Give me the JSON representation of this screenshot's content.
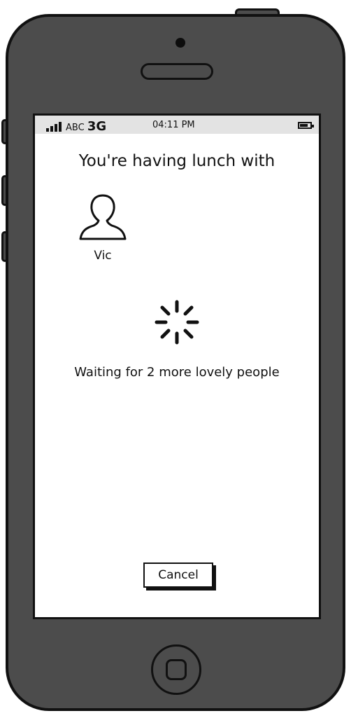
{
  "status_bar": {
    "carrier": "ABC",
    "network": "3G",
    "time": "04:11 PM"
  },
  "main": {
    "title": "You're having lunch with",
    "participant": {
      "name": "Vic",
      "icon": "person-icon"
    },
    "spinner_icon": "loading-spinner-icon",
    "waiting_text": "Waiting for 2 more lovely people"
  },
  "actions": {
    "cancel_label": "Cancel"
  },
  "colors": {
    "phone_body": "#4c4c4c",
    "outline": "#111111",
    "status_bar_bg": "#e3e3e3",
    "screen_bg": "#ffffff"
  }
}
